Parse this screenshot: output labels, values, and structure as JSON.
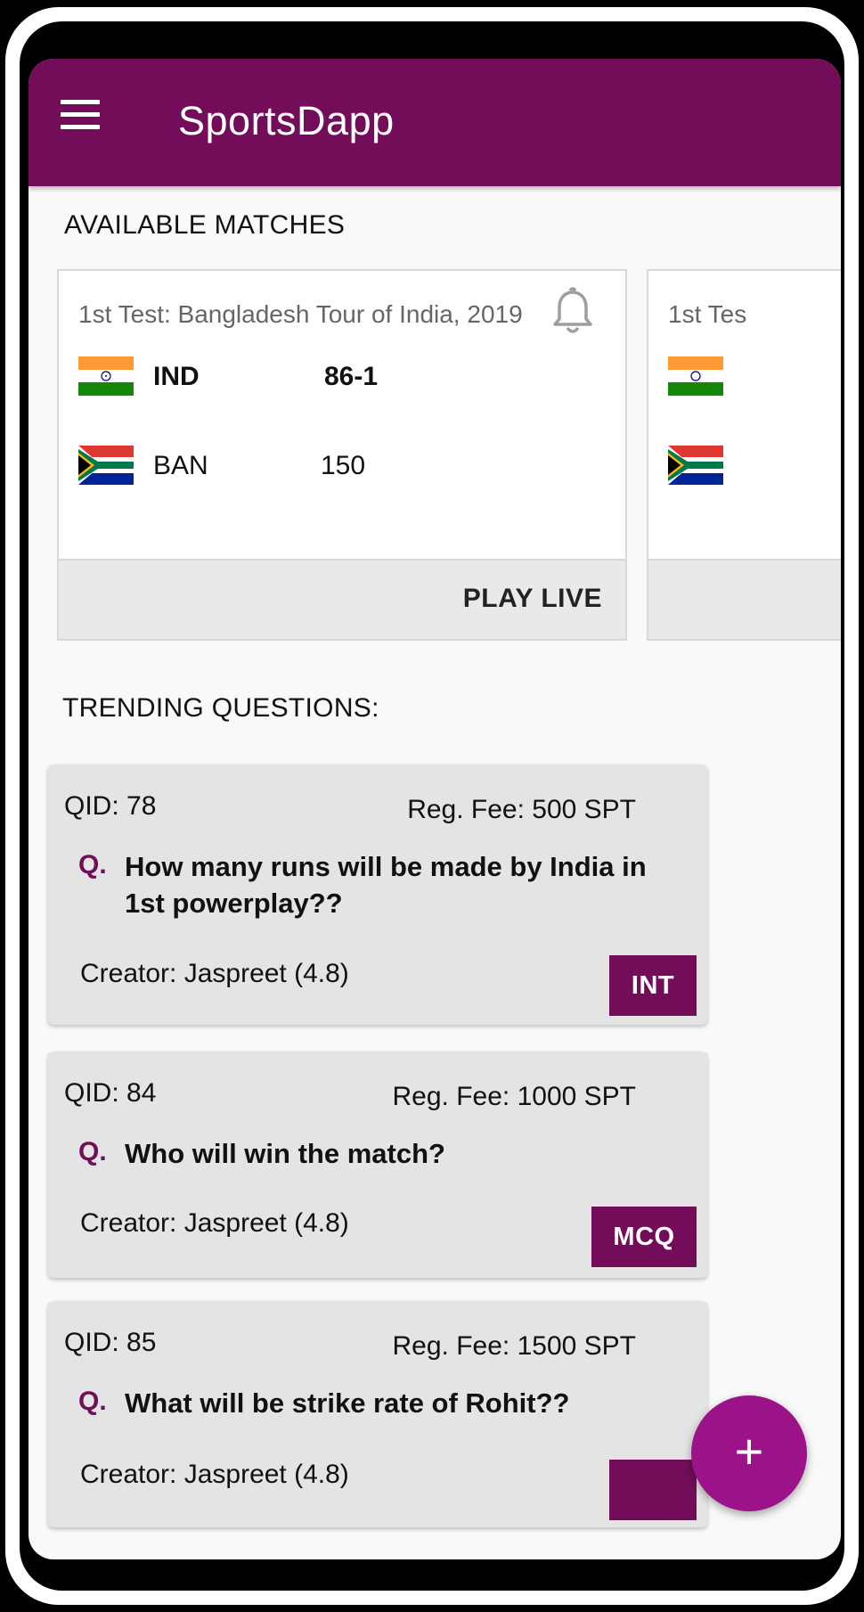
{
  "app": {
    "title": "SportsDapp"
  },
  "sections": {
    "available_matches": "AVAILABLE MATCHES",
    "trending_questions": "TRENDING QUESTIONS:"
  },
  "matches": [
    {
      "name": "1st Test: Bangladesh Tour of India, 2019",
      "teams": [
        {
          "code": "IND",
          "score": "86-1",
          "flag": "india-flag"
        },
        {
          "code": "BAN",
          "score": "150",
          "flag": "south-africa-flag"
        }
      ],
      "action_label": "PLAY LIVE"
    },
    {
      "name": "1st Tes",
      "teams": [
        {
          "flag": "india-flag"
        },
        {
          "flag": "south-africa-flag"
        }
      ]
    }
  ],
  "questions": [
    {
      "qid": "QID: 78",
      "fee": "Reg. Fee: 500 SPT",
      "prefix": "Q.",
      "text": "How many runs will be made by India in 1st powerplay??",
      "creator": "Creator: Jaspreet (4.8)",
      "type": "INT"
    },
    {
      "qid": "QID: 84",
      "fee": "Reg. Fee: 1000 SPT",
      "prefix": "Q.",
      "text": "Who will win the match?",
      "creator": "Creator: Jaspreet (4.8)",
      "type": "MCQ"
    },
    {
      "qid": "QID: 85",
      "fee": "Reg. Fee: 1500 SPT",
      "prefix": "Q.",
      "text": "What will be strike rate of Rohit??",
      "creator": "Creator: Jaspreet (4.8)",
      "type": ""
    }
  ],
  "fab": {
    "label": "+",
    "icon": "plus-icon"
  },
  "colors": {
    "primary": "#730d5a",
    "fab": "#9c1289",
    "card_bg": "#e4e4e4"
  }
}
